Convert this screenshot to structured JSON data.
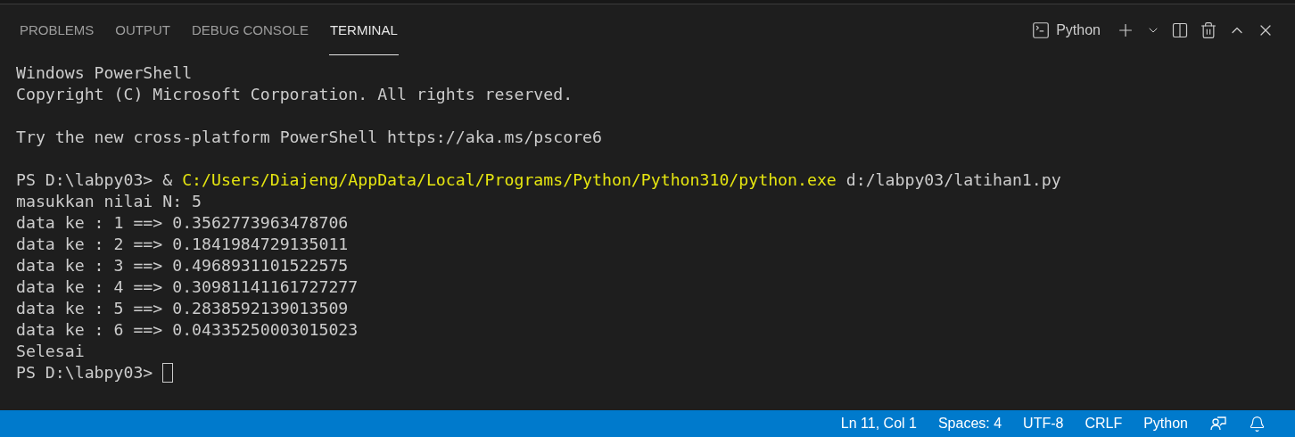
{
  "tabs": [
    {
      "label": "PROBLEMS",
      "selected": false
    },
    {
      "label": "OUTPUT",
      "selected": false
    },
    {
      "label": "DEBUG CONSOLE",
      "selected": false
    },
    {
      "label": "TERMINAL",
      "selected": true
    }
  ],
  "terminal_toolbar": {
    "profile": "Python"
  },
  "terminal": {
    "lines": [
      {
        "kind": "text",
        "cursor": false,
        "segments": [
          {
            "text": "Windows PowerShell",
            "kind": "plain"
          }
        ]
      },
      {
        "kind": "text",
        "cursor": false,
        "segments": [
          {
            "text": "Copyright (C) Microsoft Corporation. All rights reserved.",
            "kind": "plain"
          }
        ]
      },
      {
        "kind": "blank",
        "cursor": false
      },
      {
        "kind": "text",
        "cursor": false,
        "segments": [
          {
            "text": "Try the new cross-platform PowerShell https://aka.ms/pscore6",
            "kind": "plain"
          }
        ]
      },
      {
        "kind": "blank",
        "cursor": false
      },
      {
        "kind": "text",
        "cursor": false,
        "segments": [
          {
            "text": "PS D:\\labpy03> & ",
            "kind": "plain"
          },
          {
            "text": "C:/Users/Diajeng/AppData/Local/Programs/Python/Python310/python.exe",
            "kind": "path"
          },
          {
            "text": " d:/labpy03/latihan1.py",
            "kind": "plain"
          }
        ]
      },
      {
        "kind": "text",
        "cursor": false,
        "segments": [
          {
            "text": "masukkan nilai N: 5",
            "kind": "plain"
          }
        ]
      },
      {
        "kind": "text",
        "cursor": false,
        "segments": [
          {
            "text": "data ke : 1 ==> 0.3562773963478706",
            "kind": "plain"
          }
        ]
      },
      {
        "kind": "text",
        "cursor": false,
        "segments": [
          {
            "text": "data ke : 2 ==> 0.1841984729135011",
            "kind": "plain"
          }
        ]
      },
      {
        "kind": "text",
        "cursor": false,
        "segments": [
          {
            "text": "data ke : 3 ==> 0.4968931101522575",
            "kind": "plain"
          }
        ]
      },
      {
        "kind": "text",
        "cursor": false,
        "segments": [
          {
            "text": "data ke : 4 ==> 0.30981141161727277",
            "kind": "plain"
          }
        ]
      },
      {
        "kind": "text",
        "cursor": false,
        "segments": [
          {
            "text": "data ke : 5 ==> 0.2838592139013509",
            "kind": "plain"
          }
        ]
      },
      {
        "kind": "text",
        "cursor": false,
        "segments": [
          {
            "text": "data ke : 6 ==> 0.04335250003015023",
            "kind": "plain"
          }
        ]
      },
      {
        "kind": "text",
        "cursor": false,
        "segments": [
          {
            "text": "Selesai",
            "kind": "plain"
          }
        ]
      },
      {
        "kind": "text",
        "cursor": true,
        "segments": [
          {
            "text": "PS D:\\labpy03>",
            "kind": "plain"
          }
        ]
      }
    ]
  },
  "status_bar": {
    "items": [
      "Ln 11, Col 1",
      "Spaces: 4",
      "UTF-8",
      "CRLF",
      "Python"
    ]
  }
}
